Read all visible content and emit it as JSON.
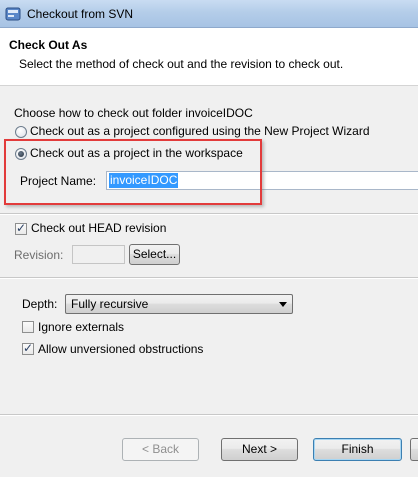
{
  "window": {
    "title": "Checkout from SVN",
    "app_icon": "svn-checkout-icon"
  },
  "header": {
    "title": "Check Out As",
    "description": "Select the method of check out and the revision to check out."
  },
  "checkout_method": {
    "prompt": "Choose how to check out folder invoiceIDOC",
    "options": [
      {
        "label": "Check out as a project configured using the New Project Wizard",
        "selected": false
      },
      {
        "label": "Check out as a project in the workspace",
        "selected": true
      }
    ],
    "project_name_label": "Project Name:",
    "project_name_value": "invoiceIDOC"
  },
  "revision": {
    "head_label": "Check out HEAD revision",
    "head_checked": true,
    "revision_label": "Revision:",
    "revision_value": "",
    "select_button": "Select..."
  },
  "options": {
    "depth_label": "Depth:",
    "depth_value": "Fully recursive",
    "ignore_externals_label": "Ignore externals",
    "ignore_externals_checked": false,
    "allow_unversioned_label": "Allow unversioned obstructions",
    "allow_unversioned_checked": true
  },
  "footer": {
    "back_button": "< Back",
    "next_button": "Next >",
    "finish_button": "Finish"
  },
  "colors": {
    "highlight_box": "#e23b3b",
    "selection": "#3399ff"
  }
}
